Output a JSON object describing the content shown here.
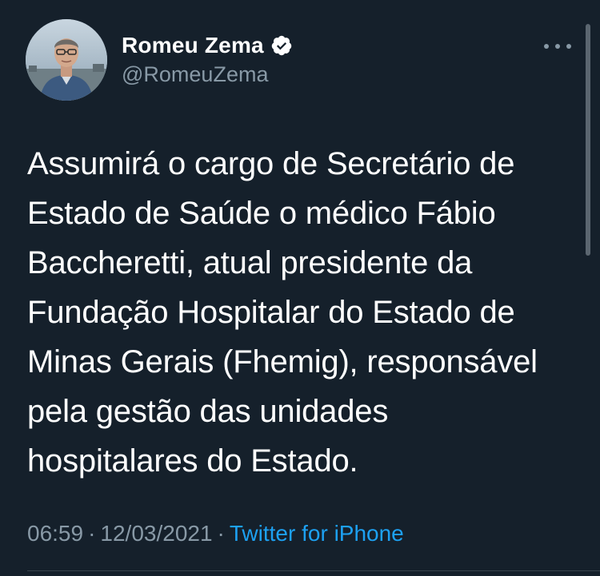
{
  "author": {
    "display_name": "Romeu Zema",
    "handle": "@RomeuZema",
    "verified": true
  },
  "tweet": {
    "lines": [
      "Assumirá o cargo de Secretário de",
      "Estado de Saúde o médico Fábio",
      "Baccheretti, atual presidente da",
      "Fundação Hospitalar do Estado de",
      "Minas Gerais (Fhemig), responsável",
      "pela gestão das unidades",
      "hospitalares do Estado."
    ]
  },
  "meta": {
    "time": "06:59",
    "sep1": "·",
    "date": "12/03/2021",
    "sep2": "·",
    "source": "Twitter for iPhone"
  },
  "icons": {
    "verified": "verified-badge-icon",
    "more": "more-options-icon"
  },
  "colors": {
    "background": "#15202b",
    "secondary_text": "#8899a6",
    "accent": "#1da1f2"
  }
}
